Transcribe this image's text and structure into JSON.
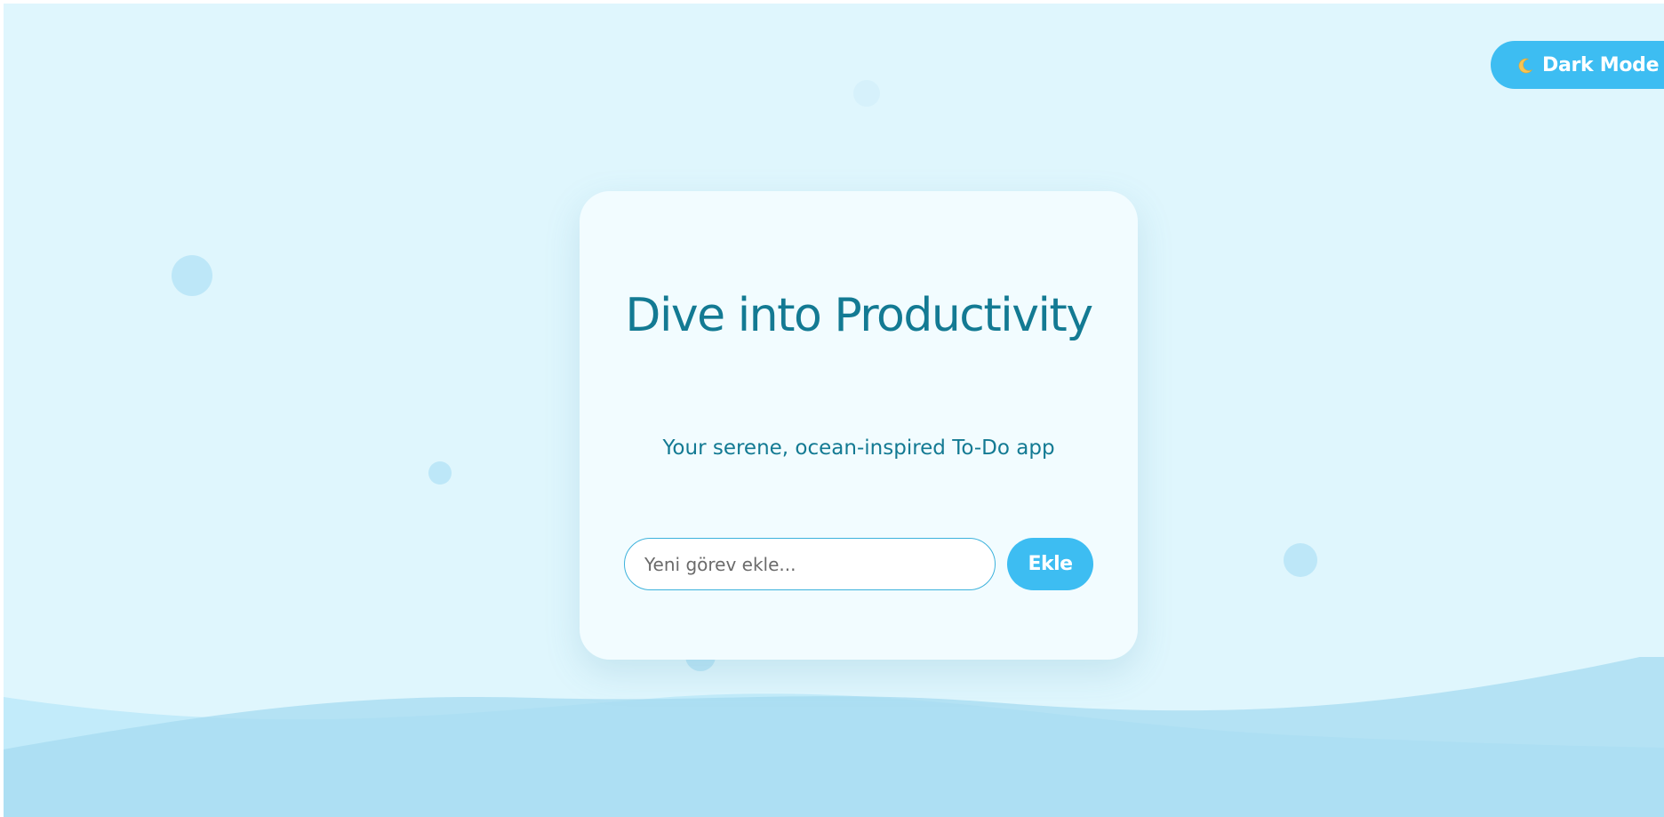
{
  "theme_toggle": {
    "icon": "crescent-moon-icon",
    "label": "Dark Mode"
  },
  "card": {
    "title": "Dive into Productivity",
    "subtitle": "Your serene, ocean-inspired To-Do app"
  },
  "task_form": {
    "placeholder": "Yeni görev ekle...",
    "value": "",
    "add_label": "Ekle"
  },
  "colors": {
    "background": "#dff6fd",
    "accent": "#3dbdf2",
    "title_text": "#137a93",
    "card_background": "#f2fcff"
  }
}
